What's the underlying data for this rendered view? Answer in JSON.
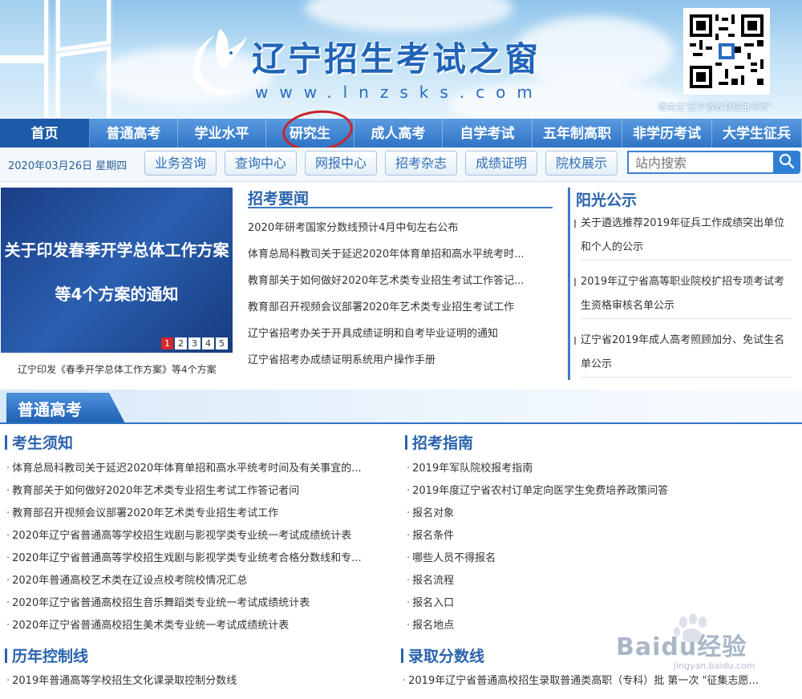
{
  "header": {
    "site_title": "辽宁招生考试之窗",
    "site_url": "www.lnzsks.com",
    "qr_caption": "请关注\"辽宁省教育招生考试\""
  },
  "nav": {
    "items": [
      "首页",
      "普通高考",
      "学业水平",
      "研究生",
      "成人高考",
      "自学考试",
      "五年制高职",
      "非学历考试",
      "大学生征兵"
    ],
    "active_index": 0,
    "highlighted": "研究生"
  },
  "subbar": {
    "date": "2020年03月26日 星期四",
    "buttons": [
      "业务咨询",
      "查询中心",
      "网报中心",
      "招考杂志",
      "成绩证明",
      "院校展示"
    ],
    "search_placeholder": "站内搜索"
  },
  "slideshow": {
    "line1": "关于印发春季开学总体工作方案",
    "line2": "等4个方案的通知",
    "pages": [
      "1",
      "2",
      "3",
      "4",
      "5"
    ],
    "active_page": "1",
    "caption": "辽宁印发《春季开学总体工作方案》等4个方案"
  },
  "news": {
    "title": "招考要闻",
    "items": [
      "2020年研考国家分数线预计4月中旬左右公布",
      "体育总局科教司关于延迟2020年体育单招和高水平统考时...",
      "教育部关于如何做好2020年艺术类专业招生考试工作答记...",
      "教育部召开视频会议部署2020年艺术类专业招生考试工作",
      "辽宁省招考办关于开具成绩证明和自考毕业证明的通知",
      "辽宁省招考办成绩证明系统用户操作手册"
    ]
  },
  "sunshine": {
    "title": "阳光公示",
    "items": [
      "关于遴选推荐2019年征兵工作成绩突出单位和个人的公示",
      "2019年辽宁省高等职业院校扩招专项考试考生资格审核名单公示",
      "辽宁省2019年成人高考照顾加分、免试生名单公示"
    ]
  },
  "section": {
    "title": "普通高考",
    "notice": {
      "title": "考生须知",
      "items": [
        "体育总局科教司关于延迟2020年体育单招和高水平统考时间及有关事宜的...",
        "教育部关于如何做好2020年艺术类专业招生考试工作答记者问",
        "教育部召开视频会议部署2020年艺术类专业招生考试工作",
        "2020年辽宁省普通高等学校招生戏剧与影视学类专业统一考试成绩统计表",
        "2020年辽宁省普通高等学校招生戏剧与影视学类专业统考合格分数线和专...",
        "2020年普通高校艺术类在辽设点校考院校情况汇总",
        "2020年辽宁省普通高校招生音乐舞蹈类专业统一考试成绩统计表",
        "2020年辽宁省普通高校招生美术类专业统一考试成绩统计表"
      ]
    },
    "guide": {
      "title": "招考指南",
      "items": [
        "2019年军队院校报考指南",
        "2019年度辽宁省农村订单定向医学生免费培养政策问答",
        "报名对象",
        "报名条件",
        "哪些人员不得报名",
        "报名流程",
        "报名入口",
        "报名地点"
      ]
    },
    "control": {
      "title": "历年控制线",
      "items": [
        "2019年普通高等学校招生文化课录取控制分数线"
      ]
    },
    "scores": {
      "title": "录取分数线",
      "items": [
        "2019年辽宁省普通高校招生录取普通类高职（专科）批 第一次 \"征集志愿..."
      ]
    }
  },
  "watermark": {
    "brand": "Baidu经验",
    "url": "jingyan.baidu.com"
  },
  "colors": {
    "nav_blue": "#2f73c5",
    "title_blue": "#2a63ad",
    "highlight_red": "#c8242a"
  }
}
